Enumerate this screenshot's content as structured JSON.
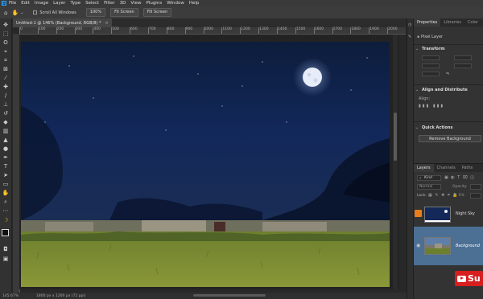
{
  "menubar": {
    "app_icon": "Ps",
    "items": [
      "File",
      "Edit",
      "Image",
      "Layer",
      "Type",
      "Select",
      "Filter",
      "3D",
      "View",
      "Plugins",
      "Window",
      "Help"
    ]
  },
  "options": {
    "scroll_all_label": "Scroll All Windows",
    "zoom_value": "100%",
    "fit_screen": "Fit Screen",
    "fill_screen": "Fill Screen"
  },
  "document": {
    "tab_title": "Untitled-1 @ 146% (Background, RGB/8) *",
    "close": "×"
  },
  "ruler": {
    "labels": [
      "0",
      "100",
      "200",
      "300",
      "400",
      "500",
      "600",
      "700",
      "800",
      "900",
      "1000",
      "1100",
      "1200",
      "1300",
      "1400",
      "1500",
      "1600",
      "1700",
      "1800",
      "1900",
      "2000"
    ]
  },
  "status": {
    "zoom": "145.67%",
    "doc_info": "1800 px x 1200 px (72 ppi)"
  },
  "panels": {
    "tabs": [
      "Properties",
      "Libraries",
      "Color"
    ],
    "layer_type": "Pixel Layer",
    "transform": "Transform",
    "align": "Align and Distribute",
    "align_sub": "Align:",
    "quick_actions": "Quick Actions",
    "remove_bg": "Remove Background"
  },
  "layers": {
    "tabs": [
      "Layers",
      "Channels",
      "Paths"
    ],
    "kind_label": "Kind",
    "blend_mode": "Normal",
    "opacity_label": "Opacity:",
    "lock_label": "Lock:",
    "fill_label": "Fill:",
    "items": [
      {
        "name": "Night Sky",
        "visible": false
      },
      {
        "name": "Background",
        "visible": true
      }
    ]
  },
  "watermark": {
    "text": "Su"
  },
  "colors": {
    "accent": "#31a8ff",
    "selected_layer": "#4c6f94",
    "badge": "#d81e1e"
  }
}
